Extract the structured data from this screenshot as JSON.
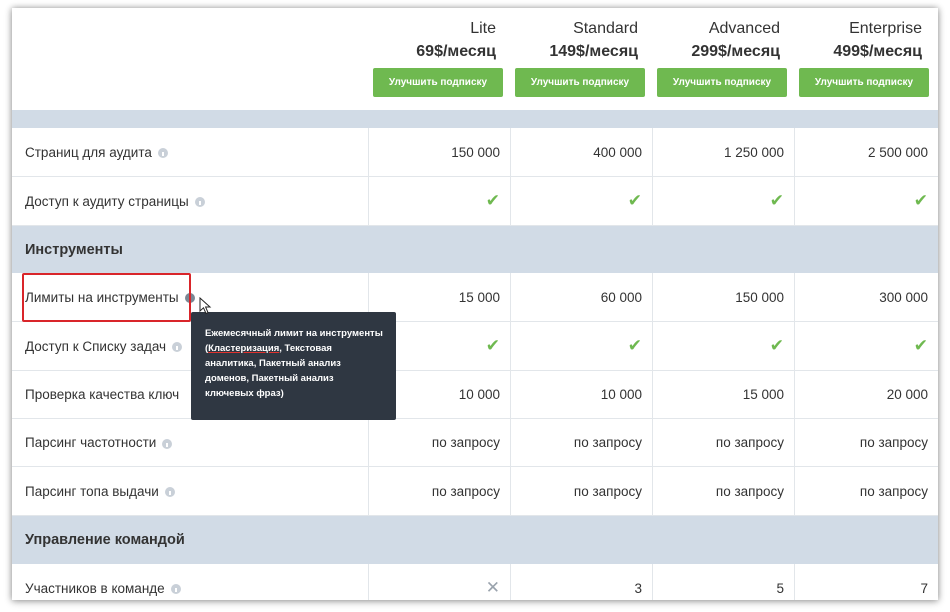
{
  "plans": [
    {
      "name": "Lite",
      "price": "69$/месяц",
      "button": "Улучшить подписку"
    },
    {
      "name": "Standard",
      "price": "149$/месяц",
      "button": "Улучшить подписку"
    },
    {
      "name": "Advanced",
      "price": "299$/месяц",
      "button": "Улучшить подписку"
    },
    {
      "name": "Enterprise",
      "price": "499$/месяц",
      "button": "Улучшить подписку"
    }
  ],
  "rows": {
    "audit_pages": {
      "label": "Страниц для аудита",
      "values": [
        "150 000",
        "400 000",
        "1 250 000",
        "2 500 000"
      ]
    },
    "page_audit_access": {
      "label": "Доступ к аудиту страницы"
    },
    "tool_limits": {
      "label": "Лимиты на инструменты",
      "values": [
        "15 000",
        "60 000",
        "150 000",
        "300 000"
      ]
    },
    "task_list_access": {
      "label": "Доступ к Списку задач"
    },
    "keyword_quality": {
      "label": "Проверка качества ключ",
      "values": [
        "10 000",
        "10 000",
        "15 000",
        "20 000"
      ]
    },
    "frequency_parsing": {
      "label": "Парсинг частотности",
      "values": [
        "по запросу",
        "по запросу",
        "по запросу",
        "по запросу"
      ]
    },
    "serp_parsing": {
      "label": "Парсинг топа выдачи",
      "values": [
        "по запросу",
        "по запросу",
        "по запросу",
        "по запросу"
      ]
    },
    "team_members": {
      "label": "Участников в команде",
      "values": [
        "3",
        "5",
        "7"
      ]
    }
  },
  "sections": {
    "tools": "Инструменты",
    "team": "Управление командой"
  },
  "tooltip": {
    "prefix": "Ежемесячный лимит на инструменты (",
    "highlight": "Кластеризация",
    "suffix": ", Текстовая аналитика, Пакетный анализ доменов, Пакетный анализ ключевых фраз)"
  },
  "icons": {
    "check": "✔",
    "cross": "✕"
  },
  "colors": {
    "accent_green": "#6fb950",
    "section_bg": "#d1dbe6",
    "tooltip_bg": "#2f3742",
    "highlight_red": "#d9252a"
  }
}
